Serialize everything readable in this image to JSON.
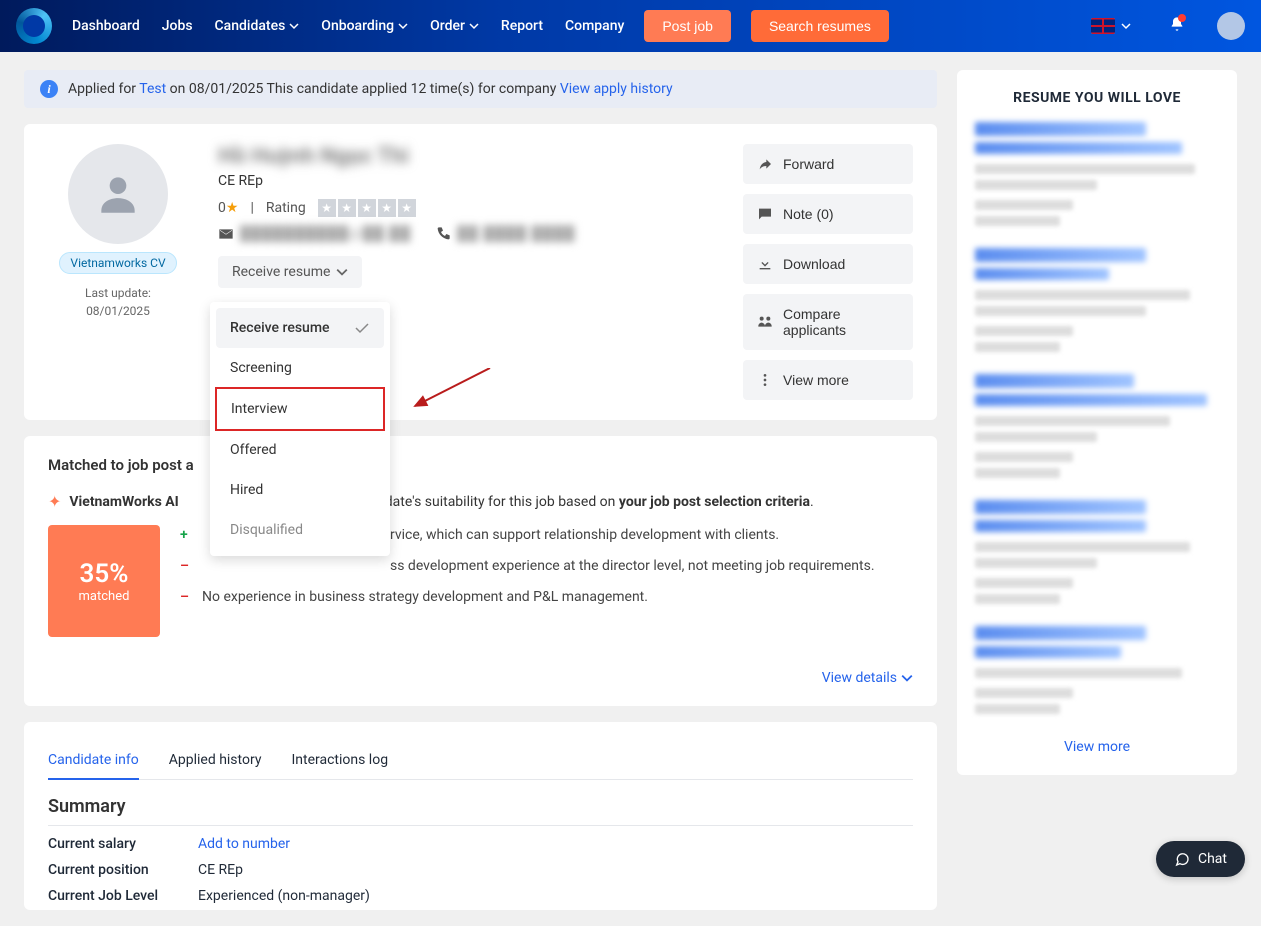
{
  "nav": {
    "dashboard": "Dashboard",
    "jobs": "Jobs",
    "candidates": "Candidates",
    "onboarding": "Onboarding",
    "order": "Order",
    "report": "Report",
    "company": "Company",
    "post_job": "Post job",
    "search_resumes": "Search resumes"
  },
  "banner": {
    "prefix": "Applied for ",
    "job_link": "Test",
    "mid": " on 08/01/2025 This candidate applied 12 time(s) for company ",
    "history_link": "View apply history"
  },
  "profile": {
    "name_hidden": "Hồ Huỳnh Ngọc Thi",
    "position": "CE REp",
    "rating_value": "0",
    "rating_label": "Rating",
    "cv_tag": "Vietnamworks CV",
    "last_update_label": "Last update:",
    "last_update_date": "08/01/2025",
    "email_hidden": "██████████@██.██",
    "phone_hidden": "██ ████ ████"
  },
  "status_button": "Receive resume",
  "status_options": {
    "receive": "Receive resume",
    "screening": "Screening",
    "interview": "Interview",
    "offered": "Offered",
    "hired": "Hired",
    "disqualified": "Disqualified"
  },
  "actions": {
    "forward": "Forward",
    "note": "Note (0)",
    "download": "Download",
    "compare": "Compare applicants",
    "view_more": "View more"
  },
  "match": {
    "title_partial": "Matched to job post a",
    "ai_prefix": "VietnamWorks AI",
    "ai_body_tail": "ndidate's suitability for this job based on ",
    "ai_criteria": "your job post selection criteria",
    "percent": "35%",
    "matched_label": "matched",
    "pros": [
      "rvice, which can support relationship development with clients."
    ],
    "cons": [
      "ss development experience at the director level, not meeting job requirements.",
      "No experience in business strategy development and P&L management."
    ],
    "view_details": "View details"
  },
  "tabs": {
    "candidate_info": "Candidate info",
    "applied_history": "Applied history",
    "interactions_log": "Interactions log"
  },
  "summary": {
    "heading": "Summary",
    "current_salary_label": "Current salary",
    "add_to_number": "Add to number",
    "current_position_label": "Current position",
    "current_position_value": "CE REp",
    "current_job_level_label": "Current Job Level",
    "current_job_level_value": "Experienced (non-manager)"
  },
  "sidebar": {
    "title": "Resume You Will Love",
    "view_more": "View more"
  },
  "chat": "Chat"
}
